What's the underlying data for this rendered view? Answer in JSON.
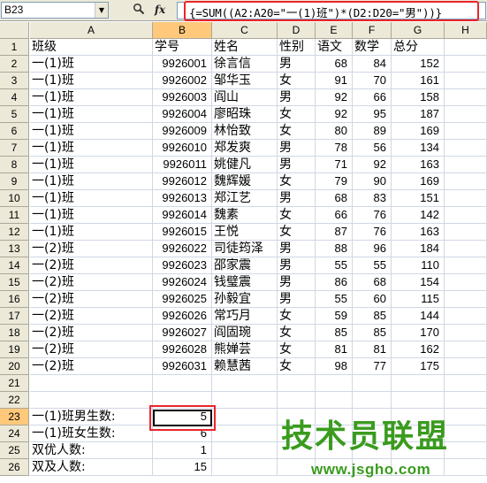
{
  "name_box": {
    "value": "B23"
  },
  "toolbar": {
    "search_icon": "magnifier-icon",
    "fx_label": "fx"
  },
  "formula_bar": {
    "formula": "{=SUM((A2:A20=\"一(1)班\")*(D2:D20=\"男\"))}"
  },
  "columns": [
    "A",
    "B",
    "C",
    "D",
    "E",
    "F",
    "G",
    "H"
  ],
  "rows": [
    {
      "num": "1",
      "cells": [
        "班级",
        "学号",
        "姓名",
        "性别",
        "语文",
        "数学",
        "总分",
        ""
      ]
    },
    {
      "num": "2",
      "cells": [
        "一(1)班",
        "9926001",
        "徐言信",
        "男",
        "68",
        "84",
        "152",
        ""
      ]
    },
    {
      "num": "3",
      "cells": [
        "一(1)班",
        "9926002",
        "邹华玉",
        "女",
        "91",
        "70",
        "161",
        ""
      ]
    },
    {
      "num": "4",
      "cells": [
        "一(1)班",
        "9926003",
        "阎山",
        "男",
        "92",
        "66",
        "158",
        ""
      ]
    },
    {
      "num": "5",
      "cells": [
        "一(1)班",
        "9926004",
        "廖昭珠",
        "女",
        "92",
        "95",
        "187",
        ""
      ]
    },
    {
      "num": "6",
      "cells": [
        "一(1)班",
        "9926009",
        "林怡致",
        "女",
        "80",
        "89",
        "169",
        ""
      ]
    },
    {
      "num": "7",
      "cells": [
        "一(1)班",
        "9926010",
        "郑发爽",
        "男",
        "78",
        "56",
        "134",
        ""
      ]
    },
    {
      "num": "8",
      "cells": [
        "一(1)班",
        "9926011",
        "姚健凡",
        "男",
        "71",
        "92",
        "163",
        ""
      ]
    },
    {
      "num": "9",
      "cells": [
        "一(1)班",
        "9926012",
        "魏辉媛",
        "女",
        "79",
        "90",
        "169",
        ""
      ]
    },
    {
      "num": "10",
      "cells": [
        "一(1)班",
        "9926013",
        "郑江艺",
        "男",
        "68",
        "83",
        "151",
        ""
      ]
    },
    {
      "num": "11",
      "cells": [
        "一(1)班",
        "9926014",
        "魏素",
        "女",
        "66",
        "76",
        "142",
        ""
      ]
    },
    {
      "num": "12",
      "cells": [
        "一(1)班",
        "9926015",
        "王悦",
        "女",
        "87",
        "76",
        "163",
        ""
      ]
    },
    {
      "num": "13",
      "cells": [
        "一(2)班",
        "9926022",
        "司徒筠泽",
        "男",
        "88",
        "96",
        "184",
        ""
      ]
    },
    {
      "num": "14",
      "cells": [
        "一(2)班",
        "9926023",
        "邵家震",
        "男",
        "55",
        "55",
        "110",
        ""
      ]
    },
    {
      "num": "15",
      "cells": [
        "一(2)班",
        "9926024",
        "钱璧震",
        "男",
        "86",
        "68",
        "154",
        ""
      ]
    },
    {
      "num": "16",
      "cells": [
        "一(2)班",
        "9926025",
        "孙毅宜",
        "男",
        "55",
        "60",
        "115",
        ""
      ]
    },
    {
      "num": "17",
      "cells": [
        "一(2)班",
        "9926026",
        "常巧月",
        "女",
        "59",
        "85",
        "144",
        ""
      ]
    },
    {
      "num": "18",
      "cells": [
        "一(2)班",
        "9926027",
        "阎固琬",
        "女",
        "85",
        "85",
        "170",
        ""
      ]
    },
    {
      "num": "19",
      "cells": [
        "一(2)班",
        "9926028",
        "熊婵芸",
        "女",
        "81",
        "81",
        "162",
        ""
      ]
    },
    {
      "num": "20",
      "cells": [
        "一(2)班",
        "9926031",
        "赖慧茜",
        "女",
        "98",
        "77",
        "175",
        ""
      ]
    },
    {
      "num": "21",
      "cells": [
        "",
        "",
        "",
        "",
        "",
        "",
        "",
        ""
      ]
    },
    {
      "num": "22",
      "cells": [
        "",
        "",
        "",
        "",
        "",
        "",
        "",
        ""
      ]
    },
    {
      "num": "23",
      "cells": [
        "一(1)班男生数:",
        "5",
        "",
        "",
        "",
        "",
        "",
        ""
      ]
    },
    {
      "num": "24",
      "cells": [
        "一(1)班女生数:",
        "6",
        "",
        "",
        "",
        "",
        "",
        ""
      ]
    },
    {
      "num": "25",
      "cells": [
        "双优人数:",
        "1",
        "",
        "",
        "",
        "",
        "",
        ""
      ]
    },
    {
      "num": "26",
      "cells": [
        "双及人数:",
        "15",
        "",
        "",
        "",
        "",
        "",
        ""
      ]
    }
  ],
  "selection": {
    "column": "B",
    "row": "23"
  },
  "watermark": {
    "title": "技术员联盟",
    "url": "www.jsgho.com"
  }
}
